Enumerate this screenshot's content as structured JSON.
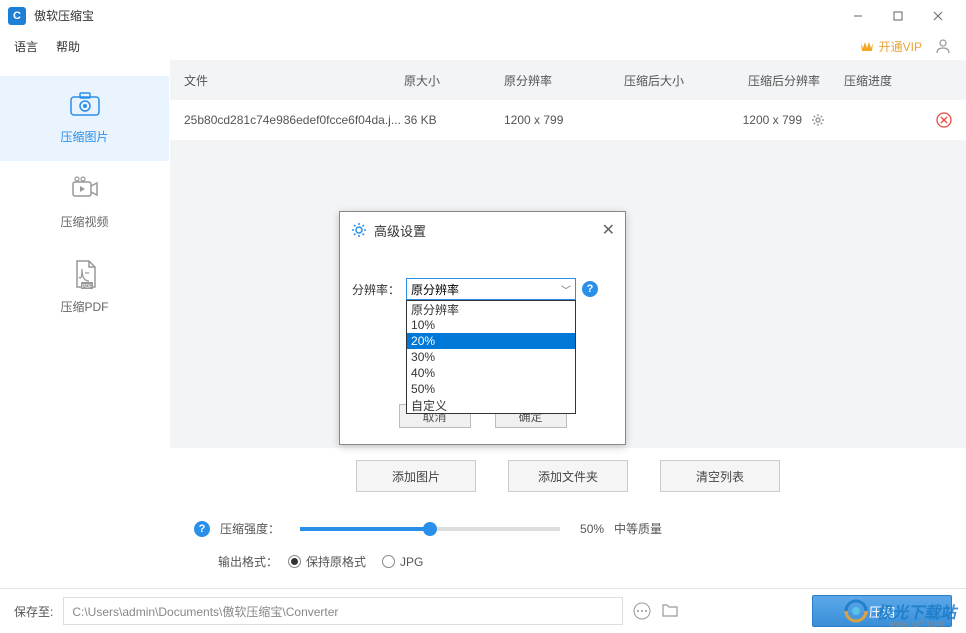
{
  "titlebar": {
    "title": "傲软压缩宝"
  },
  "menubar": {
    "language": "语言",
    "help": "帮助",
    "vip": "开通VIP"
  },
  "sidebar": {
    "items": [
      {
        "label": "压缩图片"
      },
      {
        "label": "压缩视频"
      },
      {
        "label": "压缩PDF"
      }
    ]
  },
  "table": {
    "headers": {
      "file": "文件",
      "origsize": "原大小",
      "origres": "原分辨率",
      "compsize": "压缩后大小",
      "compres": "压缩后分辨率",
      "progress": "压缩进度"
    },
    "rows": [
      {
        "file": "25b80cd281c74e986edef0fcce6f04da.j...",
        "origsize": "36 KB",
        "origres": "1200 x 799",
        "compsize": "",
        "compres": "1200 x 799",
        "progress": ""
      }
    ]
  },
  "actions": {
    "add_image": "添加图片",
    "add_folder": "添加文件夹",
    "clear_list": "清空列表"
  },
  "settings": {
    "strength_label": "压缩强度：",
    "strength_value": "50%",
    "strength_desc": "中等质量",
    "format_label": "输出格式：",
    "format_keep": "保持原格式",
    "format_jpg": "JPG"
  },
  "bottombar": {
    "saveto_label": "保存至:",
    "path": "C:\\Users\\admin\\Documents\\傲软压缩宝\\Converter",
    "compress": "压缩"
  },
  "dialog": {
    "title": "高级设置",
    "resolution_label": "分辨率：",
    "selected": "原分辨率",
    "options": [
      "原分辨率",
      "10%",
      "20%",
      "30%",
      "40%",
      "50%",
      "自定义"
    ],
    "highlighted_index": 2,
    "cancel": "取消",
    "ok": "确定"
  },
  "watermark": {
    "text": "极光下载站",
    "sub": "www.xz7.com"
  }
}
